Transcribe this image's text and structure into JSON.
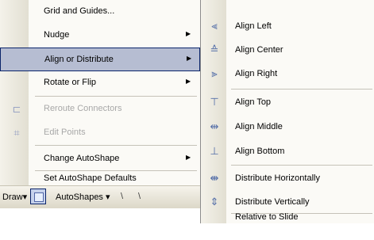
{
  "context_menu": {
    "items": [
      {
        "label": "Grid and Guides...",
        "submenu": false,
        "disabled": false,
        "icon": ""
      },
      {
        "label": "Nudge",
        "submenu": true,
        "disabled": false,
        "icon": ""
      },
      {
        "label": "Align or Distribute",
        "submenu": true,
        "disabled": false,
        "icon": "",
        "highlighted": true
      },
      {
        "label": "Rotate or Flip",
        "submenu": true,
        "disabled": false,
        "icon": ""
      },
      {
        "label": "Reroute Connectors",
        "submenu": false,
        "disabled": true,
        "icon": "reroute-connectors-icon"
      },
      {
        "label": "Edit Points",
        "submenu": false,
        "disabled": true,
        "icon": "edit-points-icon"
      },
      {
        "label": "Change AutoShape",
        "submenu": true,
        "disabled": false,
        "icon": ""
      },
      {
        "label": "Set AutoShape Defaults",
        "submenu": false,
        "disabled": false,
        "icon": ""
      }
    ],
    "submenu_arrow": "▶"
  },
  "draw_toolbar": {
    "draw_label": "Draw",
    "draw_arrow": "▾",
    "autoshapes_label": "AutoShapes",
    "autoshapes_arrow": "▾",
    "line_glyph": "\\",
    "arrow_glyph": "\\"
  },
  "align_submenu": {
    "items": [
      {
        "label": "Align Left",
        "icon": "align-left-icon",
        "glyph": "⫷"
      },
      {
        "label": "Align Center",
        "icon": "align-center-icon",
        "glyph": "≙"
      },
      {
        "label": "Align Right",
        "icon": "align-right-icon",
        "glyph": "⫸"
      },
      {
        "label": "Align Top",
        "icon": "align-top-icon",
        "glyph": "⊤"
      },
      {
        "label": "Align Middle",
        "icon": "align-middle-icon",
        "glyph": "⇹"
      },
      {
        "label": "Align Bottom",
        "icon": "align-bottom-icon",
        "glyph": "⊥"
      },
      {
        "label": "Distribute Horizontally",
        "icon": "distribute-horizontally-icon",
        "glyph": "⇼"
      },
      {
        "label": "Distribute Vertically",
        "icon": "distribute-vertically-icon",
        "glyph": "⇕"
      },
      {
        "label": "Relative to Slide",
        "icon": "",
        "glyph": ""
      }
    ]
  },
  "colors": {
    "highlight": "#b6bdd2",
    "highlight_border": "#0a246a",
    "disabled_text": "#a8a8a8",
    "menu_bg": "#fbfaf6"
  }
}
